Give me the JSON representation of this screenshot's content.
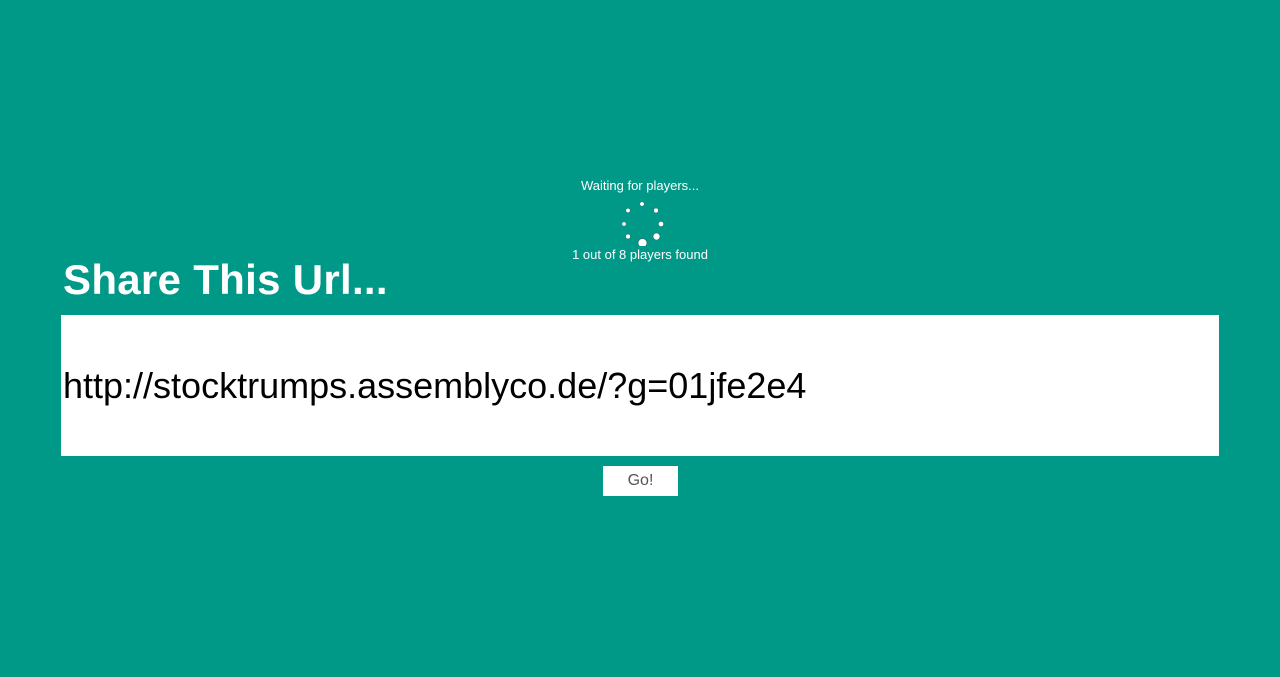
{
  "lobby": {
    "status_text": "Waiting for players...",
    "spinner_icon": "loading-spinner-icon",
    "players_found_text": "1 out of 8 players found"
  },
  "share": {
    "title": "Share This Url...",
    "url_value": "http://stocktrumps.assemblyco.de/?g=01jfe2e4",
    "go_label": "Go!"
  },
  "colors": {
    "background": "#009887",
    "text": "#ffffff",
    "field_background": "#ffffff",
    "button_text": "#555555"
  }
}
